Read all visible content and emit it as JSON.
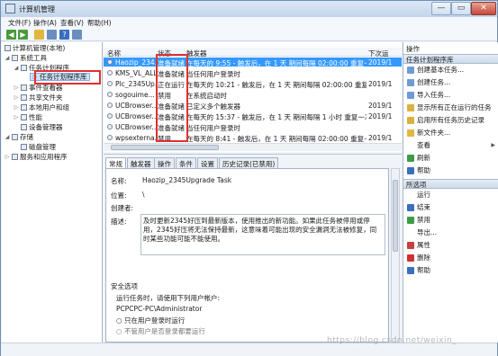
{
  "window": {
    "title": "计算机管理",
    "controls": [
      "—",
      "▭",
      "✕"
    ]
  },
  "menu": [
    "文件(F)",
    "操作(A)",
    "查看(V)",
    "帮助(H)"
  ],
  "tree": {
    "root": "计算机管理(本地)",
    "system_tools": "系统工具",
    "task_scheduler": "任务计划程序",
    "task_library": "任务计划程序库",
    "event_viewer": "事件查看器",
    "shared_folders": "共享文件夹",
    "local_users": "本地用户和组",
    "performance": "性能",
    "device_manager": "设备管理器",
    "storage": "存储",
    "disk_mgmt": "磁盘管理",
    "services_apps": "服务和应用程序"
  },
  "task_list": {
    "columns": {
      "name": "名称",
      "status": "状态",
      "triggers": "触发器",
      "next_run": "下次运"
    },
    "rows": [
      {
        "name": "Haozip_234...",
        "status": "准备就绪",
        "trigger": "在每天的 9:55 - 触发后，在 1 天 期间每隔 02:00:00 重复一次。",
        "next": "2019/1"
      },
      {
        "name": "KMS_VL_ALL",
        "status": "准备就绪",
        "trigger": "当任何用户登录时",
        "next": ""
      },
      {
        "name": "Plc_2345Up...",
        "status": "正在运行",
        "trigger": "在每天的 10:21 - 触发后，在 1 天 期间每隔 02:00:00 重复一次。",
        "next": "2019/1"
      },
      {
        "name": "sogouime...",
        "status": "禁用",
        "trigger": "在系统启动时",
        "next": ""
      },
      {
        "name": "UCBrowser...",
        "status": "准备就绪",
        "trigger": "已定义多个触发器",
        "next": "2019/1"
      },
      {
        "name": "UCBrowser...",
        "status": "准备就绪",
        "trigger": "在每天的 15:37 - 触发后，在 1 天 期间每隔 1 小时 重复一次。",
        "next": "2019/1"
      },
      {
        "name": "UCBrowser...",
        "status": "准备就绪",
        "trigger": "当任何用户登录时",
        "next": ""
      },
      {
        "name": "wpsexterna...",
        "status": "禁用",
        "trigger": "在每天的 8:41 - 触发后，在 1 天 期间每隔 02:00:00 重复一次。",
        "next": "2019/1"
      }
    ]
  },
  "details": {
    "tabs": [
      "常规",
      "触发器",
      "操作",
      "条件",
      "设置",
      "历史记录(已禁用)"
    ],
    "name_label": "名称:",
    "name_value": "Haozip_2345Upgrade Task",
    "location_label": "位置:",
    "location_value": "\\",
    "author_label": "创建者:",
    "desc_label": "描述:",
    "desc_value": "及时更新2345好压到最新版本，使用推出的新功能。如果此任务被停用或停用，2345好压将无法保持最新，这意味着可能出现的安全漏洞无法被修复，同时某些功能可能不能使用。",
    "security_title": "安全选项",
    "run_as_label": "运行任务时，请使用下列用户帐户:",
    "account": "PCPCPC-PC\\Administrator",
    "radio_logged_on": "只在用户登录时运行",
    "radio_cut": "不管用户是否登录都要运行"
  },
  "actions": {
    "header": "操作",
    "section1": "任务计划程序库",
    "section1_items": [
      "创建基本任务...",
      "创建任务...",
      "导入任务...",
      "显示所有正在运行的任务",
      "启用所有任务历史记录",
      "新文件夹...",
      "查看",
      "刷新",
      "帮助"
    ],
    "section2": "所选项",
    "section2_items": [
      "运行",
      "结束",
      "禁用",
      "导出...",
      "属性",
      "删除",
      "帮助"
    ]
  },
  "watermark": "https://blog.csdn.net/weixin_",
  "colors": {
    "selection": "#3399ff",
    "highlight_box": "#e03030",
    "section_header": "#cfdceb"
  }
}
